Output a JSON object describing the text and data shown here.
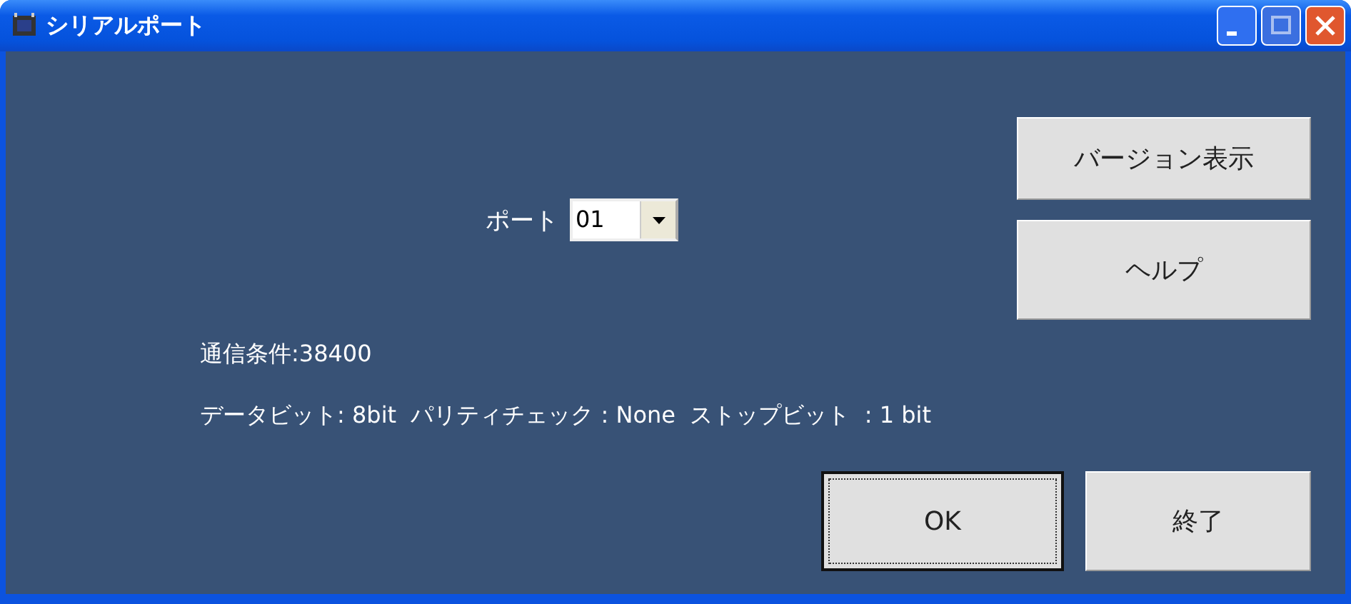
{
  "window": {
    "title": "シリアルポート"
  },
  "side_buttons": [
    {
      "label": "バージョン表示"
    },
    {
      "label": "ヘルプ"
    }
  ],
  "port": {
    "label": "ポート",
    "value": "01"
  },
  "info": [
    "通信条件:38400",
    "データビット: 8bit  パリティチェック : None  ストップビット  : 1 bit"
  ],
  "buttons": [
    {
      "label": "OK",
      "focused": true
    },
    {
      "label": "終了",
      "focused": false
    }
  ]
}
